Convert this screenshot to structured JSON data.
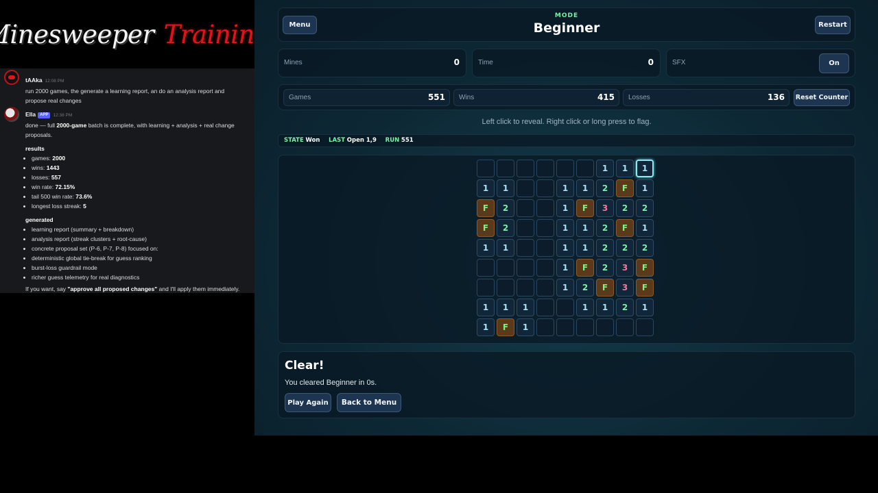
{
  "banner": {
    "word1": "Minesweeper",
    "word2": "Training"
  },
  "chat": {
    "msg1": {
      "user": "tAAka",
      "time": "12:08 PM",
      "text": "run 2000 games, the generate a learning report, an do an analysis report and propose real changes"
    },
    "msg2": {
      "user": "Ella",
      "badge": "APP",
      "time": "12:38 PM",
      "intro_a": "done — full ",
      "intro_b": "2000-game",
      "intro_c": " batch is complete, with learning + analysis + real change proposals.",
      "results_title": "results",
      "results": [
        {
          "k": "games: ",
          "v": "2000"
        },
        {
          "k": "wins: ",
          "v": "1443"
        },
        {
          "k": "losses: ",
          "v": "557"
        },
        {
          "k": "win rate: ",
          "v": "72.15%"
        },
        {
          "k": "tail 500 win rate: ",
          "v": "73.6%"
        },
        {
          "k": "longest loss streak: ",
          "v": "5"
        }
      ],
      "generated_title": "generated",
      "generated": [
        "learning report (summary + breakdown)",
        "analysis report (streak clusters + root-cause)",
        "concrete proposal set (P-6, P-7, P-8) focused on:",
        "deterministic global tie-break for guess ranking",
        "burst-loss guardrail mode",
        "richer guess telemetry for real diagnostics"
      ],
      "footer_a": "If you want, say ",
      "footer_b": "\"approve all proposed changes\"",
      "footer_c": " and I'll apply them immediately."
    }
  },
  "header": {
    "menu_label": "Menu",
    "mode_label": "MODE",
    "mode_value": "Beginner",
    "restart_label": "Restart"
  },
  "stats1": {
    "mines_label": "Mines",
    "mines_value": "0",
    "time_label": "Time",
    "time_value": "0",
    "sfx_label": "SFX",
    "sfx_button": "On"
  },
  "stats2": {
    "games_label": "Games",
    "games_value": "551",
    "wins_label": "Wins",
    "wins_value": "415",
    "losses_label": "Losses",
    "losses_value": "136",
    "reset_label": "Reset Counter"
  },
  "hint": "Left click to reveal. Right click or long press to flag.",
  "status": {
    "state_label": "STATE",
    "state_value": "Won",
    "last_label": "LAST",
    "last_value": "Open 1,9",
    "run_label": "RUN",
    "run_value": "551"
  },
  "board": [
    [
      "",
      "",
      "",
      "",
      "",
      "",
      "1",
      "1",
      "1*"
    ],
    [
      "1",
      "1",
      "",
      "",
      "1",
      "1",
      "2",
      "F",
      "1"
    ],
    [
      "F",
      "2",
      "",
      "",
      "1",
      "F",
      "3",
      "2",
      "2"
    ],
    [
      "F",
      "2",
      "",
      "",
      "1",
      "1",
      "2",
      "F",
      "1"
    ],
    [
      "1",
      "1",
      "",
      "",
      "1",
      "1",
      "2",
      "2",
      "2"
    ],
    [
      "",
      "",
      "",
      "",
      "1",
      "F",
      "2",
      "3",
      "F"
    ],
    [
      "",
      "",
      "",
      "",
      "1",
      "2",
      "F",
      "3",
      "F"
    ],
    [
      "1",
      "1",
      "1",
      "",
      "",
      "1",
      "1",
      "2",
      "1"
    ],
    [
      "1",
      "F",
      "1",
      "",
      "",
      "",
      "",
      "",
      ""
    ]
  ],
  "result": {
    "title": "Clear!",
    "text": "You cleared Beginner in 0s.",
    "play_again": "Play Again",
    "back_to_menu": "Back to Menu"
  },
  "colors": {
    "accent_green": "#7cf0a6",
    "num1": "#a9e0f5",
    "num3": "#f27a9a",
    "flag_bg": "#5b3a1c"
  }
}
